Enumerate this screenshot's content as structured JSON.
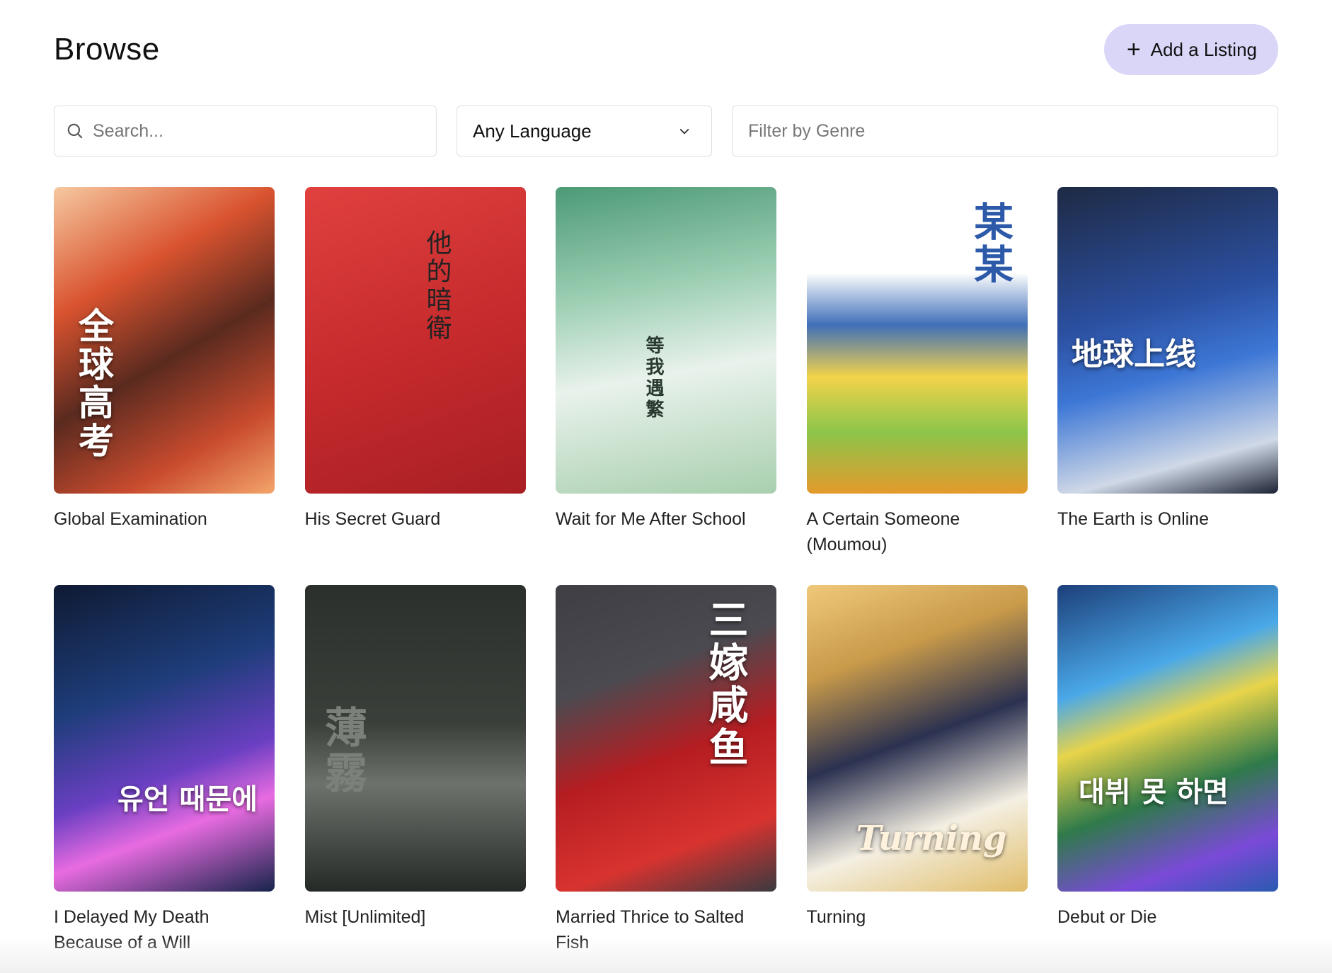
{
  "header": {
    "title": "Browse",
    "add_button_label": "Add a Listing"
  },
  "filters": {
    "search_placeholder": "Search...",
    "language_selected": "Any Language",
    "genre_placeholder": "Filter by Genre"
  },
  "colors": {
    "add_button_bg": "#d9d6f8",
    "field_border": "#e0e0e0"
  },
  "listings": [
    {
      "title": "Global Examination",
      "cover_text": "全球高考",
      "cover_bg": "linear-gradient(150deg,#f6c9a0 0%,#d9532f 30%,#5a2a1f 55%,#c94b2e 80%,#f3a56b 100%)"
    },
    {
      "title": "His Secret Guard",
      "cover_text": "他的暗衛",
      "cover_bg": "linear-gradient(160deg,#e0413f 0%,#c72b2d 50%,#a81f24 100%)"
    },
    {
      "title": "Wait for Me After School",
      "cover_text": "等我遇繁",
      "cover_bg": "linear-gradient(170deg,#4c9a76 0%,#9fd0b5 35%,#e9f2ec 60%,#a8cfae 100%)"
    },
    {
      "title": "A Certain Someone (Moumou)",
      "cover_text": "某某",
      "cover_bg": "linear-gradient(180deg,#ffffff 0%,#ffffff 28%,#3f6fb8 45%,#f3d34a 62%,#8cc54a 80%,#e49a2c 100%)"
    },
    {
      "title": "The Earth is Online",
      "cover_text": "地球上线",
      "cover_bg": "linear-gradient(165deg,#1e2a44 0%,#2b4fa0 40%,#3d77d6 60%,#cfd8e6 85%,#1b2233 100%)"
    },
    {
      "title": "I Delayed My Death Because of a Will",
      "cover_text": "유언 때문에",
      "cover_bg": "linear-gradient(160deg,#0f1a33 0%,#1e3d7a 35%,#6a3fc2 60%,#e86be1 75%,#16244a 100%)"
    },
    {
      "title": "Mist [Unlimited]",
      "cover_text": "薄霧",
      "cover_bg": "linear-gradient(180deg,#2c302c 0%,#3a3f3a 45%,#6d726d 65%,#262a26 100%)"
    },
    {
      "title": "Married Thrice to Salted Fish",
      "cover_text": "三嫁咸鱼",
      "cover_bg": "linear-gradient(160deg,#3e3e44 0%,#4a4a50 30%,#b51d22 55%,#d8332f 80%,#3a3a40 100%)"
    },
    {
      "title": "Turning",
      "cover_text": "Turning",
      "cover_bg": "linear-gradient(160deg,#f0c87a 0%,#c89a4a 25%,#2b3150 50%,#f4efe2 75%,#e0bd6a 100%)"
    },
    {
      "title": "Debut or Die",
      "cover_text": "대뷔 못 하면",
      "cover_bg": "linear-gradient(160deg,#1c3f7a 0%,#4aa8e8 30%,#e8d44a 45%,#2f7a4a 65%,#7a4ad8 85%,#2a5ab0 100%)"
    }
  ]
}
